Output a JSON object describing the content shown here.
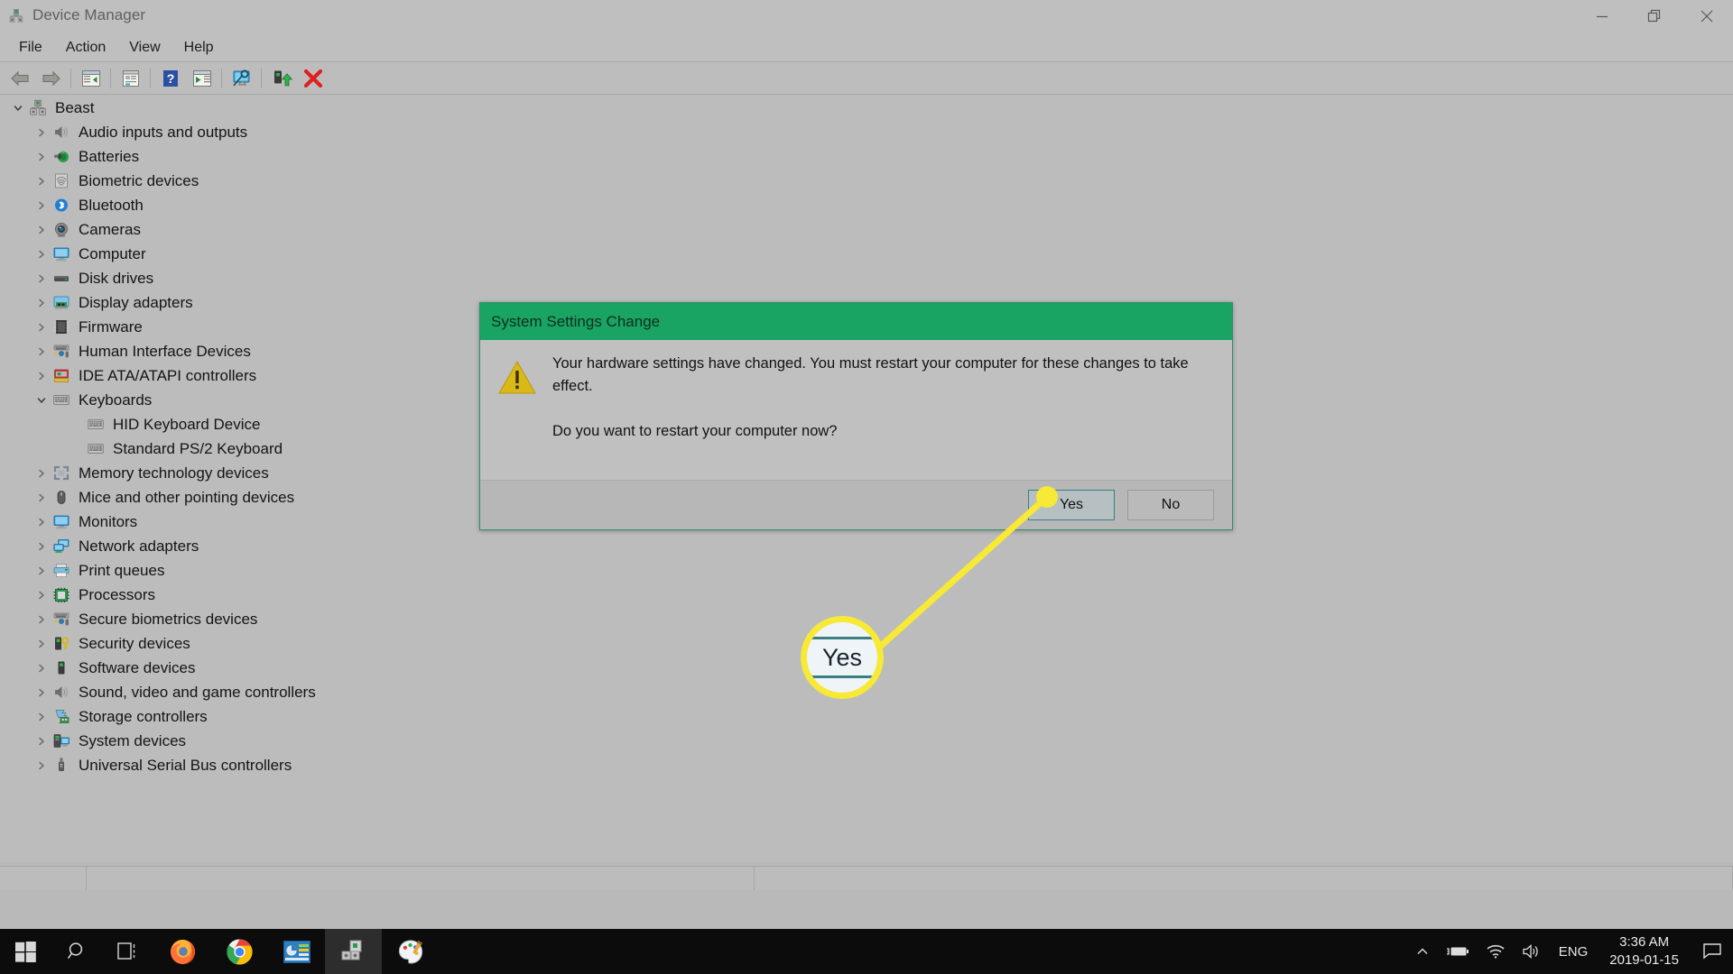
{
  "window": {
    "title": "Device Manager",
    "icon": "device-manager-icon",
    "controls": {
      "minimize": "Minimize",
      "restore": "Restore",
      "close": "Close"
    }
  },
  "menubar": {
    "items": [
      "File",
      "Action",
      "View",
      "Help"
    ]
  },
  "toolbar": {
    "buttons": [
      {
        "name": "back-icon",
        "tip": "Back"
      },
      {
        "name": "forward-icon",
        "tip": "Forward"
      },
      {
        "name": "show-hide-console-tree-icon",
        "tip": "Show/hide console tree"
      },
      {
        "name": "properties-icon",
        "tip": "Properties"
      },
      {
        "name": "help-icon",
        "tip": "Help"
      },
      {
        "name": "update-driver-icon",
        "tip": "Update driver"
      },
      {
        "name": "scan-for-hardware-changes-icon",
        "tip": "Scan for hardware changes"
      },
      {
        "name": "enable-device-icon",
        "tip": "Enable device"
      },
      {
        "name": "uninstall-device-icon",
        "tip": "Uninstall device"
      }
    ]
  },
  "tree": {
    "root": {
      "label": "Beast",
      "icon": "computer-root-icon",
      "expanded": true
    },
    "items": [
      {
        "label": "Audio inputs and outputs",
        "icon": "speaker-icon",
        "expanded": false,
        "depth": 1
      },
      {
        "label": "Batteries",
        "icon": "battery-icon",
        "expanded": false,
        "depth": 1
      },
      {
        "label": "Biometric devices",
        "icon": "fingerprint-icon",
        "expanded": false,
        "depth": 1
      },
      {
        "label": "Bluetooth",
        "icon": "bluetooth-icon",
        "expanded": false,
        "depth": 1
      },
      {
        "label": "Cameras",
        "icon": "camera-icon",
        "expanded": false,
        "depth": 1
      },
      {
        "label": "Computer",
        "icon": "monitor-icon",
        "expanded": false,
        "depth": 1
      },
      {
        "label": "Disk drives",
        "icon": "disk-drive-icon",
        "expanded": false,
        "depth": 1
      },
      {
        "label": "Display adapters",
        "icon": "display-adapter-icon",
        "expanded": false,
        "depth": 1
      },
      {
        "label": "Firmware",
        "icon": "firmware-chip-icon",
        "expanded": false,
        "depth": 1
      },
      {
        "label": "Human Interface Devices",
        "icon": "hid-icon",
        "expanded": false,
        "depth": 1
      },
      {
        "label": "IDE ATA/ATAPI controllers",
        "icon": "ide-controller-icon",
        "expanded": false,
        "depth": 1
      },
      {
        "label": "Keyboards",
        "icon": "keyboard-icon",
        "expanded": true,
        "depth": 1
      },
      {
        "label": "HID Keyboard Device",
        "icon": "keyboard-icon",
        "expanded": null,
        "depth": 2
      },
      {
        "label": "Standard PS/2 Keyboard",
        "icon": "keyboard-icon",
        "expanded": null,
        "depth": 2
      },
      {
        "label": "Memory technology devices",
        "icon": "memory-icon",
        "expanded": false,
        "depth": 1
      },
      {
        "label": "Mice and other pointing devices",
        "icon": "mouse-icon",
        "expanded": false,
        "depth": 1
      },
      {
        "label": "Monitors",
        "icon": "monitor-icon",
        "expanded": false,
        "depth": 1
      },
      {
        "label": "Network adapters",
        "icon": "network-icon",
        "expanded": false,
        "depth": 1
      },
      {
        "label": "Print queues",
        "icon": "printer-icon",
        "expanded": false,
        "depth": 1
      },
      {
        "label": "Processors",
        "icon": "processor-icon",
        "expanded": false,
        "depth": 1
      },
      {
        "label": "Secure biometrics devices",
        "icon": "hid-icon",
        "expanded": false,
        "depth": 1
      },
      {
        "label": "Security devices",
        "icon": "security-key-icon",
        "expanded": false,
        "depth": 1
      },
      {
        "label": "Software devices",
        "icon": "software-device-icon",
        "expanded": false,
        "depth": 1
      },
      {
        "label": "Sound, video and game controllers",
        "icon": "speaker-icon",
        "expanded": false,
        "depth": 1
      },
      {
        "label": "Storage controllers",
        "icon": "storage-controller-icon",
        "expanded": false,
        "depth": 1
      },
      {
        "label": "System devices",
        "icon": "system-device-icon",
        "expanded": false,
        "depth": 1
      },
      {
        "label": "Universal Serial Bus controllers",
        "icon": "usb-icon",
        "expanded": false,
        "depth": 1
      }
    ]
  },
  "dialog": {
    "title": "System Settings Change",
    "title_bar_color": "#19a463",
    "icon": "warning-triangle-icon",
    "message_line1": "Your hardware settings have changed. You must restart your computer for these changes to take effect.",
    "message_line2": "Do you want to restart your computer now?",
    "buttons": {
      "yes": "Yes",
      "no": "No"
    },
    "focused_button": "Yes"
  },
  "callout": {
    "magnified_label": "Yes",
    "highlight_color": "#f7e935"
  },
  "taskbar": {
    "items": [
      {
        "name": "start-button",
        "label": "Start",
        "running": false
      },
      {
        "name": "search-icon",
        "label": "Search",
        "running": false
      },
      {
        "name": "task-view-icon",
        "label": "Task View",
        "running": false
      },
      {
        "name": "firefox-icon",
        "label": "Firefox",
        "running": true
      },
      {
        "name": "chrome-icon",
        "label": "Google Chrome",
        "running": true
      },
      {
        "name": "control-panel-icon",
        "label": "Control Panel",
        "running": true
      },
      {
        "name": "device-manager-icon",
        "label": "Device Manager",
        "running": true,
        "active": true
      },
      {
        "name": "paint-icon",
        "label": "Paint",
        "running": true
      }
    ],
    "tray": {
      "show_hidden": "show-hidden-icons-chevron",
      "icons": [
        "battery-charging-icon",
        "wifi-icon",
        "volume-icon"
      ],
      "language": "ENG",
      "time": "3:36 AM",
      "date": "2019-01-15",
      "action_center": "action-center-icon"
    }
  }
}
